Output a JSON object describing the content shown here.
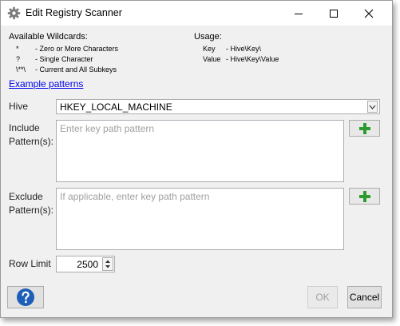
{
  "window": {
    "title": "Edit Registry Scanner"
  },
  "wildcards": {
    "heading": "Available Wildcards:",
    "items": [
      {
        "symbol": "*",
        "description": "- Zero or More Characters"
      },
      {
        "symbol": "?",
        "description": "- Single Character"
      },
      {
        "symbol": "\\**\\",
        "description": "- Current and All Subkeys"
      }
    ]
  },
  "usage": {
    "heading": "Usage:",
    "items": [
      {
        "key": "Key",
        "value": "- Hive\\Key\\"
      },
      {
        "key": "Value",
        "value": "- Hive\\Key\\Value"
      }
    ]
  },
  "example_link": "Example patterns",
  "hive": {
    "label": "Hive",
    "value": "HKEY_LOCAL_MACHINE"
  },
  "include": {
    "label_line1": "Include",
    "label_line2": "Pattern(s):",
    "placeholder": "Enter key path pattern"
  },
  "exclude": {
    "label_line1": "Exclude",
    "label_line2": "Pattern(s):",
    "placeholder": "If applicable, enter key path pattern"
  },
  "row_limit": {
    "label": "Row Limit",
    "value": "2500"
  },
  "buttons": {
    "ok": "OK",
    "cancel": "Cancel"
  },
  "colors": {
    "plus_green": "#2e9b2e",
    "help_blue": "#1d5fb8"
  }
}
